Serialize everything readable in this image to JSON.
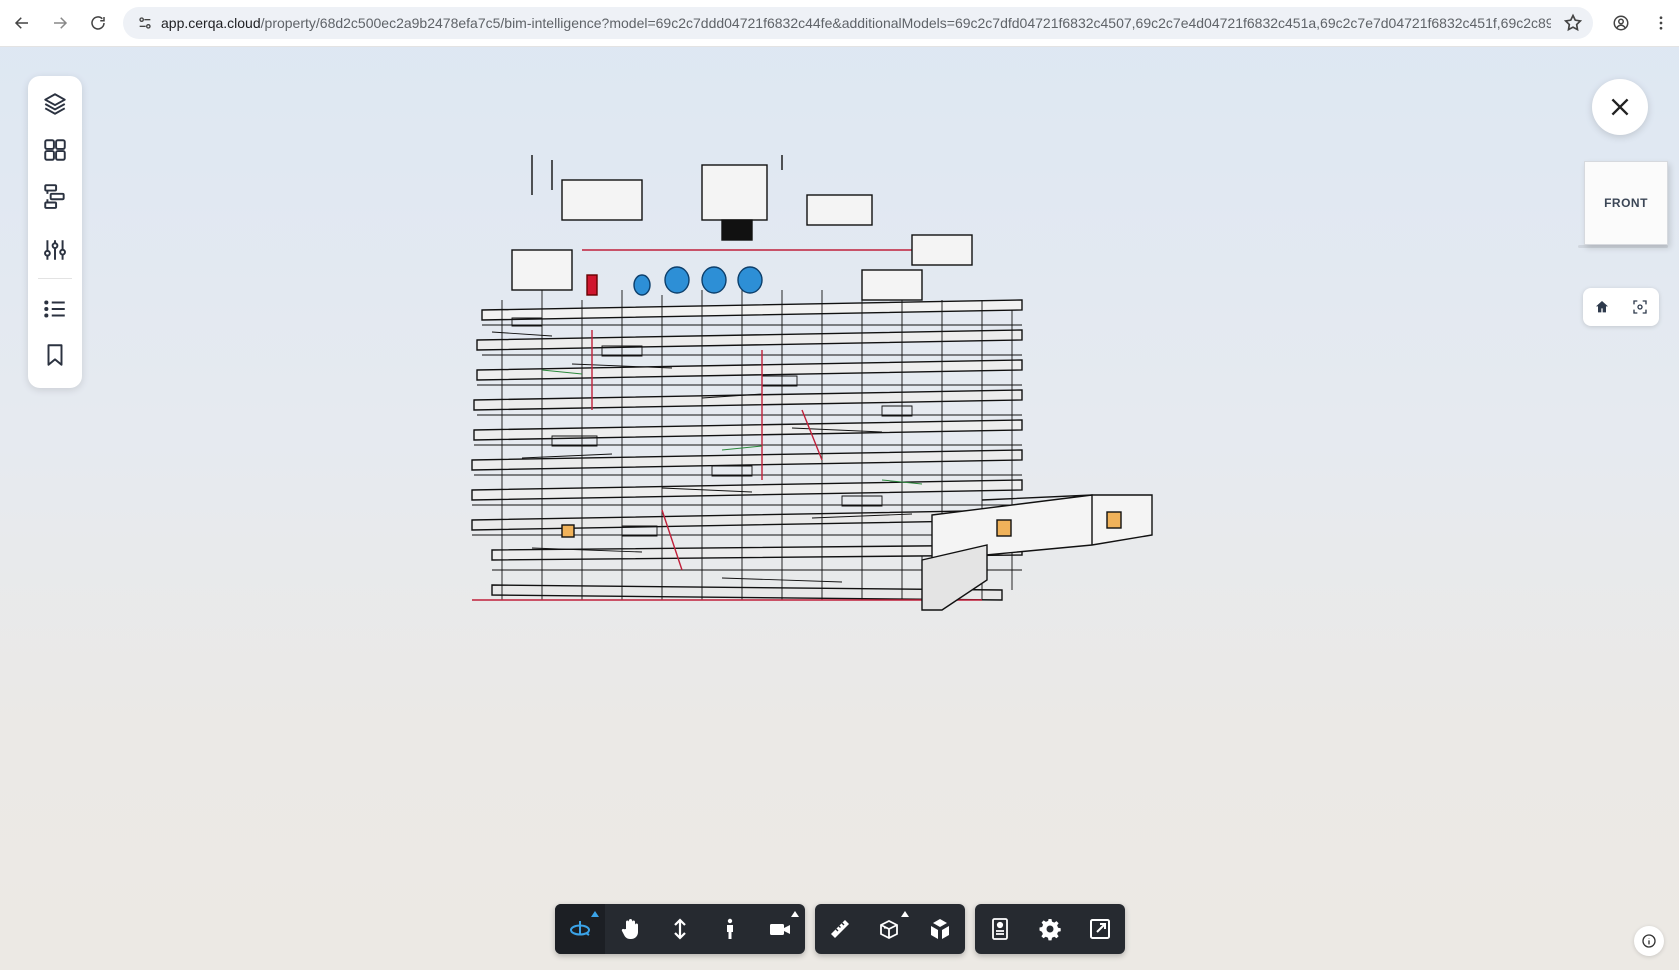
{
  "browser": {
    "url_host": "app.cerqa.cloud",
    "url_path": "/property/68d2c500ec2a9b2478efa7c5/bim-intelligence?model=69c2c7ddd04721f6832c44fe&additionalModels=69c2c7dfd04721f6832c4507,69c2c7e4d04721f6832c451a,69c2c7e7d04721f6832c451f,69c2c89..."
  },
  "left_rail": {
    "items": [
      {
        "icon": "layers-icon"
      },
      {
        "icon": "grid-icon"
      },
      {
        "icon": "hierarchy-icon"
      },
      {
        "icon": "sliders-icon"
      },
      {
        "icon": "list-icon"
      },
      {
        "icon": "bookmark-icon"
      }
    ]
  },
  "viewcube": {
    "face_label": "FRONT"
  },
  "toolbar": {
    "groups": [
      [
        "orbit-icon",
        "pan-hand-icon",
        "vertical-move-icon",
        "walk-person-icon",
        "camera-icon"
      ],
      [
        "measure-ruler-icon",
        "section-box-icon",
        "explode-cube-icon"
      ],
      [
        "properties-panel-icon",
        "settings-gear-icon",
        "fullscreen-icon"
      ]
    ],
    "active": "orbit-icon"
  },
  "colors": {
    "toolbar_bg": "#262a30",
    "active_accent": "#3ba3e8",
    "model_pipe_red": "#c0203a",
    "model_tank_blue": "#2d8fd6"
  }
}
